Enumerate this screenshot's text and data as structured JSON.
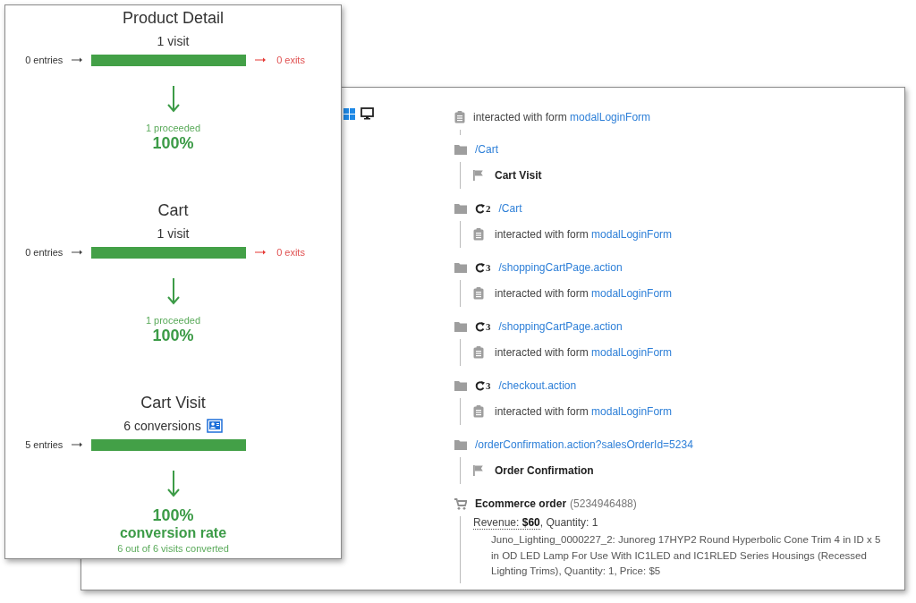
{
  "funnel": {
    "steps": [
      {
        "title": "Product Detail",
        "count": "1 visit",
        "entries": "0 entries",
        "exits": "0 exits",
        "proceeded": "1 proceeded",
        "percent": "100%"
      },
      {
        "title": "Cart",
        "count": "1 visit",
        "entries": "0 entries",
        "exits": "0 exits",
        "proceeded": "1 proceeded",
        "percent": "100%"
      },
      {
        "title": "Cart Visit",
        "count": "6 conversions",
        "conversion_icon": true,
        "entries": "5 entries",
        "percent": "100%",
        "rate_label": "conversion rate",
        "summary": "6 out of 6 visits converted"
      }
    ]
  },
  "visitor": {
    "os_icon": true,
    "device_icon": true
  },
  "timeline": [
    {
      "kind": "form",
      "text": "interacted with form",
      "link": "modalLoginForm"
    },
    {
      "kind": "page",
      "url": "/Cart",
      "children": [
        {
          "kind": "goal",
          "label": "Cart Visit"
        }
      ]
    },
    {
      "kind": "page",
      "repeat": "2",
      "url": "/Cart",
      "children": [
        {
          "kind": "form",
          "text": "interacted with form",
          "link": "modalLoginForm"
        }
      ]
    },
    {
      "kind": "page",
      "repeat": "3",
      "url": "/shoppingCartPage.action",
      "children": [
        {
          "kind": "form",
          "text": "interacted with form",
          "link": "modalLoginForm"
        }
      ]
    },
    {
      "kind": "page",
      "repeat": "3",
      "url": "/shoppingCartPage.action",
      "children": [
        {
          "kind": "form",
          "text": "interacted with form",
          "link": "modalLoginForm"
        }
      ]
    },
    {
      "kind": "page",
      "repeat": "3",
      "url": "/checkout.action",
      "children": [
        {
          "kind": "form",
          "text": "interacted with form",
          "link": "modalLoginForm"
        }
      ]
    },
    {
      "kind": "page",
      "url": "/orderConfirmation.action?salesOrderId=5234",
      "children": [
        {
          "kind": "goal",
          "label": "Order Confirmation"
        }
      ]
    },
    {
      "kind": "order",
      "title": "Ecommerce order",
      "id": "(5234946488)",
      "revenue": "Revenue: **$60**",
      "quantity": ", Quantity: 1",
      "item": "Juno_Lighting_0000227_2: Junoreg 17HYP2 Round Hyperbolic Cone Trim 4 in ID x 5 in OD LED Lamp For Use With IC1LED and IC1RLED Series Housings (Recessed Lighting Trims), Quantity: 1, Price: $5"
    }
  ]
}
